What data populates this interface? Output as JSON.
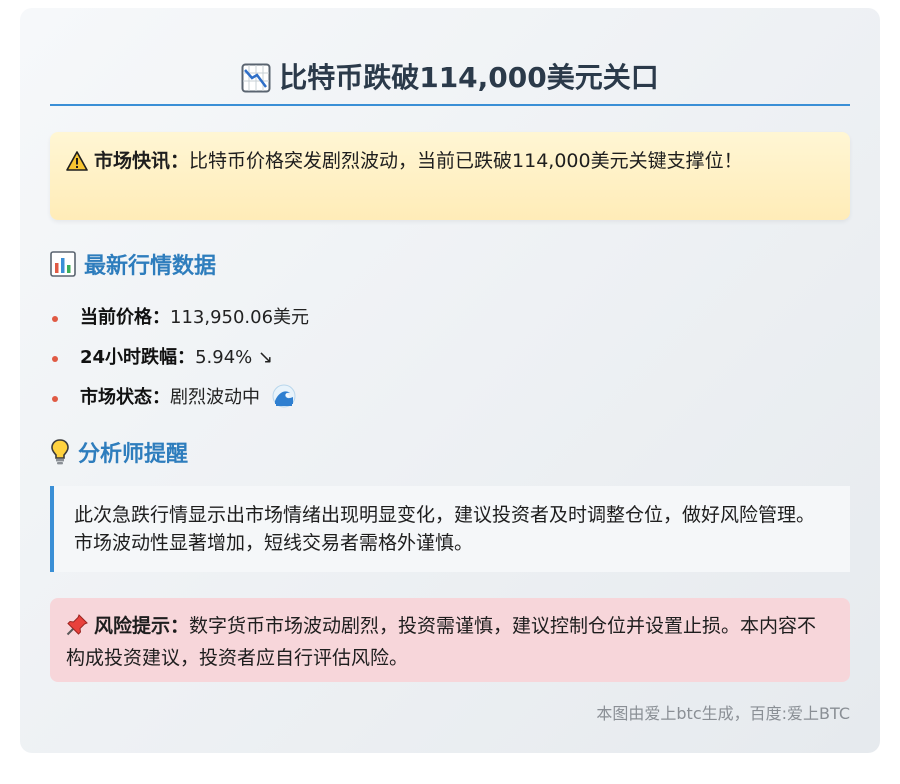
{
  "title": {
    "icon": "chart-decreasing-icon",
    "text": "比特币跌破114,000美元关口"
  },
  "alert": {
    "icon": "warning-icon",
    "label": "市场快讯：",
    "text": "比特币价格突发剧烈波动，当前已跌破114,000美元关键支撑位！"
  },
  "market": {
    "icon": "bar-chart-icon",
    "heading": "最新行情数据",
    "items": [
      {
        "label": "当前价格：",
        "value": "113,950.06美元"
      },
      {
        "label": "24小时跌幅：",
        "value": "5.94% ↘"
      },
      {
        "label": "市场状态：",
        "value": "剧烈波动中",
        "icon": "wave-icon"
      }
    ]
  },
  "analyst": {
    "icon": "light-bulb-icon",
    "heading": "分析师提醒",
    "text": "此次急跌行情显示出市场情绪出现明显变化，建议投资者及时调整仓位，做好风险管理。市场波动性显著增加，短线交易者需格外谨慎。"
  },
  "risk": {
    "icon": "pushpin-icon",
    "label": "风险提示：",
    "text": "数字货币市场波动剧烈，投资需谨慎，建议控制仓位并设置止损。本内容不构成投资建议，投资者应自行评估风险。"
  },
  "footer": {
    "text": "本图由爱上btc生成，百度:爱上BTC"
  },
  "colors": {
    "accent": "#3a8fd6",
    "heading": "#2e7dbd",
    "bullet": "#e05a44",
    "alert_bg": "#ffecb8",
    "risk_bg": "#f7d6da"
  }
}
